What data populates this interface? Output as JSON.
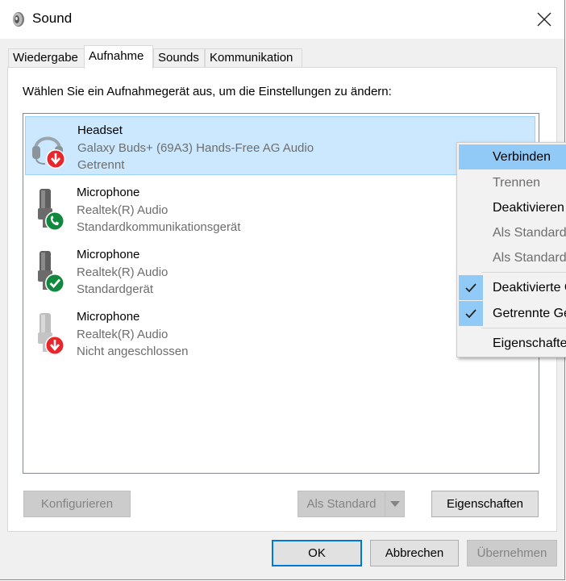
{
  "window": {
    "title": "Sound",
    "icon": "speaker-icon"
  },
  "tabs": [
    {
      "label": "Wiedergabe",
      "active": false
    },
    {
      "label": "Aufnahme",
      "active": true
    },
    {
      "label": "Sounds",
      "active": false
    },
    {
      "label": "Kommunikation",
      "active": false
    }
  ],
  "instruction": "Wählen Sie ein Aufnahmegerät aus, um die Einstellungen zu ändern:",
  "devices": [
    {
      "name": "Headset",
      "driver": "Galaxy Buds+ (69A3) Hands-Free AG Audio",
      "status": "Getrennt",
      "icon": "headset-icon",
      "badge": "red-down-arrow",
      "selected": true
    },
    {
      "name": "Microphone",
      "driver": "Realtek(R) Audio",
      "status": "Standardkommunikationsgerät",
      "icon": "microphone-icon",
      "badge": "green-phone",
      "selected": false
    },
    {
      "name": "Microphone",
      "driver": "Realtek(R) Audio",
      "status": "Standardgerät",
      "icon": "microphone-icon",
      "badge": "green-check",
      "selected": false
    },
    {
      "name": "Microphone",
      "driver": "Realtek(R) Audio",
      "status": "Nicht angeschlossen",
      "icon": "microphone-icon",
      "badge": "red-down-arrow",
      "selected": false
    }
  ],
  "buttons": {
    "configure": "Konfigurieren",
    "set_default": "Als Standard",
    "properties": "Eigenschaften",
    "ok": "OK",
    "cancel": "Abbrechen",
    "apply": "Übernehmen"
  },
  "context_menu": [
    {
      "label": "Verbinden",
      "state": "highlighted"
    },
    {
      "label": "Trennen",
      "state": "disabled"
    },
    {
      "label": "Deaktivieren",
      "state": "enabled"
    },
    {
      "label": "Als Standardgerät",
      "state": "disabled"
    },
    {
      "label": "Als Standardkommunikationsgerät",
      "state": "disabled"
    },
    {
      "label": "Deaktivierte Geräte anzeigen",
      "state": "checked"
    },
    {
      "label": "Getrennte Geräte anzeigen",
      "state": "checked"
    },
    {
      "label": "Eigenschaften",
      "state": "enabled"
    }
  ],
  "colors": {
    "selection": "#cce8ff",
    "menu_highlight": "#91c9f7",
    "accent": "#0078d7"
  }
}
